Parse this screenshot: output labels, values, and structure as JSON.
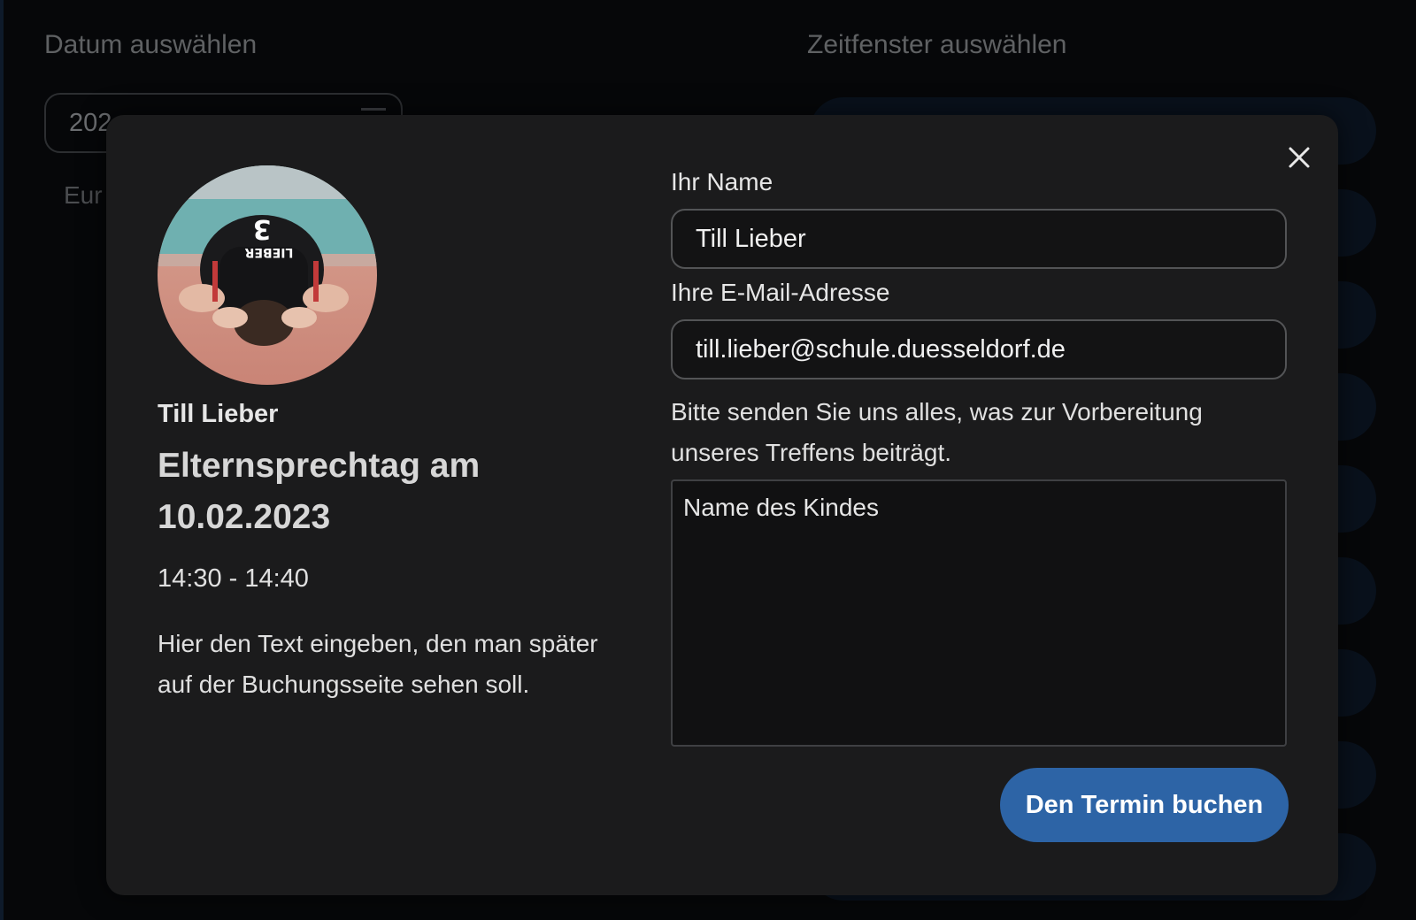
{
  "background": {
    "date_label": "Datum auswählen",
    "date_value": "202",
    "timezone_text": "Eur",
    "slot_label": "Zeitfenster auswählen"
  },
  "modal": {
    "person_name": "Till Lieber",
    "event_title": "Elternsprechtag am 10.02.2023",
    "time_range": "14:30 - 14:40",
    "description": "Hier den Text eingeben, den man später auf der Buchungsseite sehen soll.",
    "form": {
      "name_label": "Ihr Name",
      "name_value": "Till Lieber",
      "email_label": "Ihre E-Mail-Adresse",
      "email_value": "till.lieber@schule.duesseldorf.de",
      "notes_hint": "Bitte senden Sie uns alles, was zur Vorbereitung unseres Treffens beiträgt.",
      "notes_value": "Name des Kindes",
      "submit_label": "Den Termin buchen"
    }
  },
  "colors": {
    "modal_bg": "#1b1b1c",
    "primary_button": "#2d64a6"
  },
  "icons": {
    "close": "close-icon",
    "calendar": "calendar-icon"
  }
}
